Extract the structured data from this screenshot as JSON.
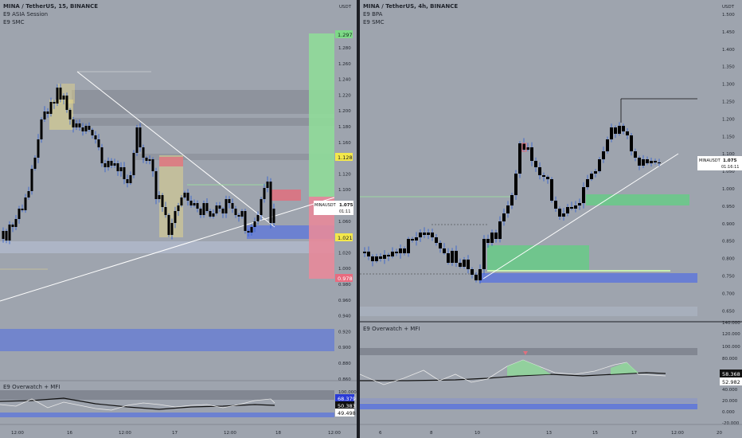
{
  "left": {
    "title": "MINA / TetherUS, 15, BINANCE",
    "indicators": [
      "E9 ASIA Session",
      "E9 SMC"
    ],
    "axis_unit": "USDT",
    "price_ticks": [
      "1.280",
      "1.260",
      "1.240",
      "1.220",
      "1.200",
      "1.180",
      "1.160",
      "1.140",
      "1.120",
      "1.100",
      "1.080",
      "1.060",
      "1.040",
      "1.020",
      "1.000",
      "0.980",
      "0.960",
      "0.940",
      "0.920",
      "0.900",
      "0.880",
      "0.860"
    ],
    "price_tags": [
      {
        "value": "1.297",
        "bg": "#7ed987",
        "fg": "#10301a"
      },
      {
        "value": "1.128",
        "bg": "#f4e84a",
        "fg": "#222"
      },
      {
        "value": "1.021",
        "bg": "#f4e84a",
        "fg": "#222"
      },
      {
        "value": "0.978",
        "bg": "#e86b7f",
        "fg": "#fff"
      }
    ],
    "symbol_tag": {
      "symbol": "MINAUSDT",
      "price": "1.075",
      "timer": "01:11"
    },
    "osc_title": "E9 Overwatch + MFI",
    "osc_ticks": [
      "100.000",
      "80.000"
    ],
    "osc_tags": [
      {
        "value": "68.379",
        "bg": "#2a3bd6",
        "fg": "#fff"
      },
      {
        "value": "50.383",
        "bg": "#111",
        "fg": "#fff"
      },
      {
        "value": "49.498",
        "bg": "#fff",
        "fg": "#111"
      }
    ],
    "time_labels": [
      "12:00",
      "16",
      "12:00",
      "17",
      "12:00",
      "18",
      "12:00"
    ]
  },
  "right": {
    "title": "MINA / TetherUS, 4h, BINANCE",
    "indicators": [
      "E9 BPA",
      "E9 SMC"
    ],
    "axis_unit": "USDT",
    "price_ticks": [
      "1.500",
      "1.450",
      "1.400",
      "1.350",
      "1.300",
      "1.250",
      "1.200",
      "1.150",
      "1.100",
      "1.050",
      "1.000",
      "0.950",
      "0.900",
      "0.850",
      "0.800",
      "0.750",
      "0.700",
      "0.650"
    ],
    "symbol_tag": {
      "symbol": "MINAUSDT",
      "price": "1.075",
      "timer": "01:16:11"
    },
    "osc_title": "E9 Overwatch + MFI",
    "osc_ticks": [
      "140.000",
      "120.000",
      "100.000",
      "80.000",
      "40.000",
      "20.000",
      "0.000",
      "-20.000"
    ],
    "osc_tags": [
      {
        "value": "58.368",
        "bg": "#111",
        "fg": "#fff"
      },
      {
        "value": "52.982",
        "bg": "#fff",
        "fg": "#111"
      }
    ],
    "time_labels": [
      "6",
      "8",
      "10",
      "13",
      "15",
      "17",
      "12:00",
      "20"
    ]
  },
  "colors": {
    "bg": "#9ea4ae",
    "candle": "#000000",
    "wick": "#2b5cd1",
    "bull_zone": "#6ac98a",
    "bear_zone": "#e0707e",
    "demand": "#4f6ee0"
  }
}
